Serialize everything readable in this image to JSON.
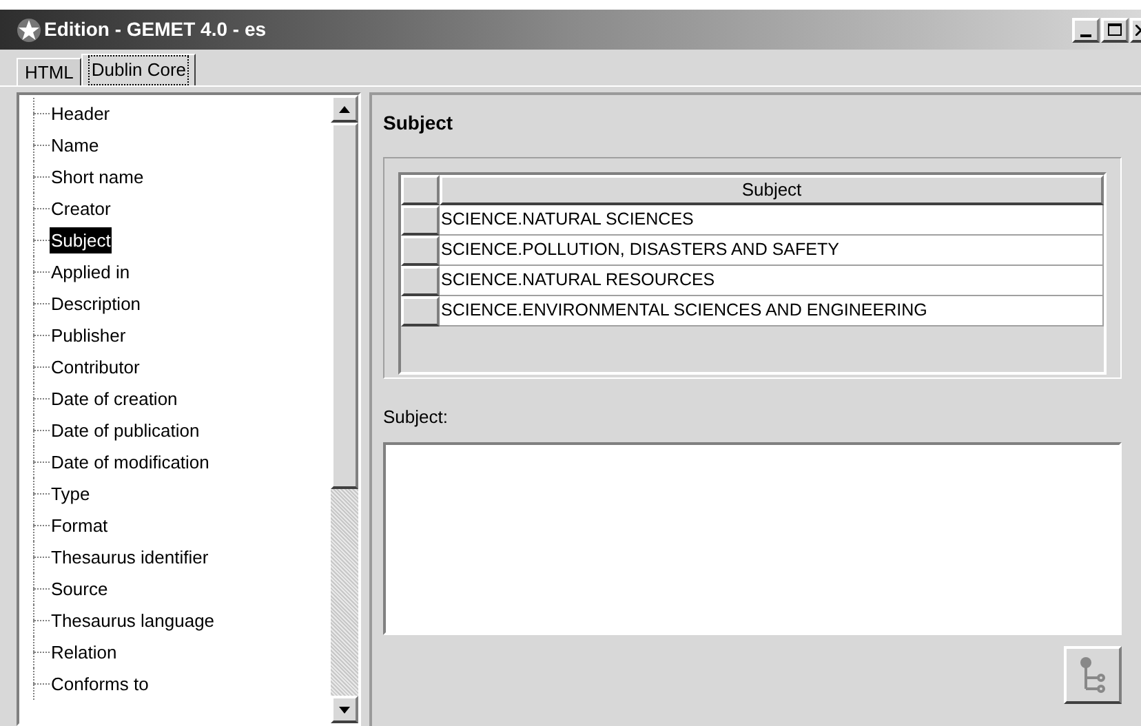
{
  "window": {
    "title": "Edition - GEMET 4.0 - es"
  },
  "tabs": [
    {
      "label": "HTML",
      "selected": false
    },
    {
      "label": "Dublin Core",
      "selected": true
    }
  ],
  "tree": {
    "items": [
      {
        "label": "Header",
        "selected": false
      },
      {
        "label": "Name",
        "selected": false
      },
      {
        "label": "Short name",
        "selected": false
      },
      {
        "label": "Creator",
        "selected": false
      },
      {
        "label": "Subject",
        "selected": true
      },
      {
        "label": "Applied in",
        "selected": false
      },
      {
        "label": "Description",
        "selected": false
      },
      {
        "label": "Publisher",
        "selected": false
      },
      {
        "label": "Contributor",
        "selected": false
      },
      {
        "label": "Date of creation",
        "selected": false
      },
      {
        "label": "Date of publication",
        "selected": false
      },
      {
        "label": "Date of modification",
        "selected": false
      },
      {
        "label": "Type",
        "selected": false
      },
      {
        "label": "Format",
        "selected": false
      },
      {
        "label": "Thesaurus identifier",
        "selected": false
      },
      {
        "label": "Source",
        "selected": false
      },
      {
        "label": "Thesaurus language",
        "selected": false
      },
      {
        "label": "Relation",
        "selected": false
      },
      {
        "label": "Conforms to",
        "selected": false
      }
    ]
  },
  "panel": {
    "title": "Subject",
    "table": {
      "columns": [
        "Subject"
      ],
      "rows": [
        "SCIENCE.NATURAL SCIENCES",
        "SCIENCE.POLLUTION, DISASTERS AND SAFETY",
        "SCIENCE.NATURAL RESOURCES",
        "SCIENCE.ENVIRONMENTAL SCIENCES AND ENGINEERING"
      ]
    },
    "field_label": "Subject:"
  }
}
